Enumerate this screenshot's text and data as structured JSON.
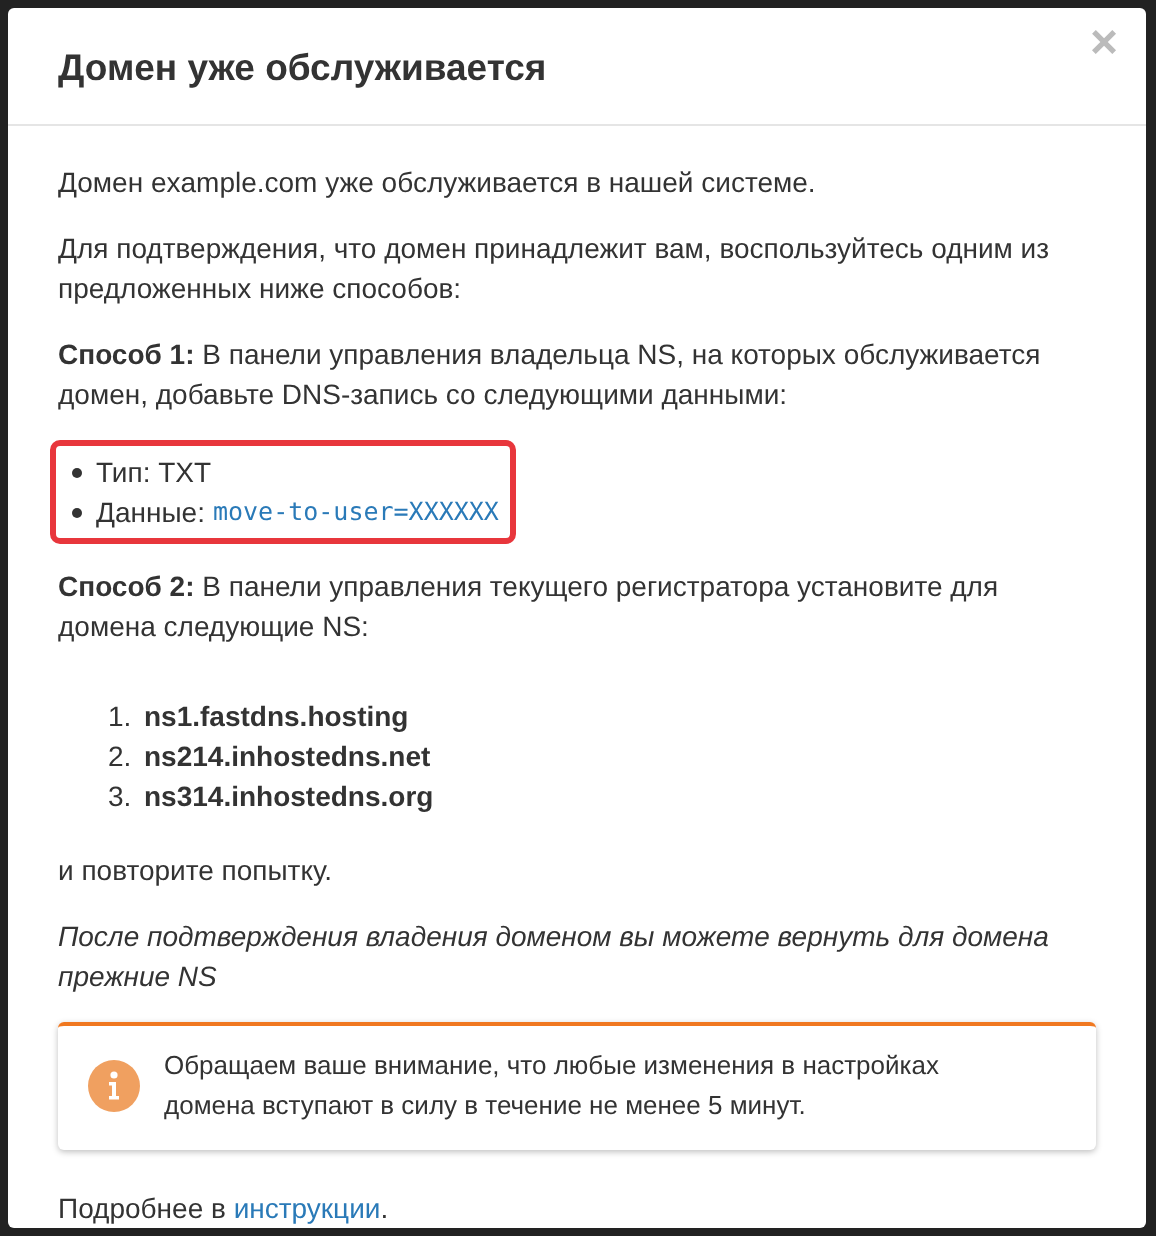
{
  "dialog": {
    "title": "Домен уже обслуживается",
    "close": "×"
  },
  "body": {
    "intro": "Домен example.com уже обслуживается в нашей системе.",
    "prompt": "Для подтверждения, что домен принадлежит вам, воспользуйтесь одним из предложенных ниже способов:",
    "method_1": "**Способ 1:** В панели управления владельца NS, на которых обслуживается домен, добавьте DNS-запись со следующими данными:",
    "record": [
      {
        "label": "Тип: TXT"
      },
      {
        "label": "Данные:",
        "code": "move-to-user=XXXXXX"
      }
    ],
    "method_2": "**Способ 2:** В панели управления текущего регистратора установите для домена следующие NS:",
    "nameservers": [
      {
        "number": "1.",
        "host": "ns1.fastdns.hosting"
      },
      {
        "number": "2.",
        "host": "ns214.inhostedns.net"
      },
      {
        "number": "3.",
        "host": "ns314.inhostedns.org"
      }
    ],
    "retry": "и повторите попытку.",
    "note": "После подтверждения владения доменом вы можете вернуть для домена прежние NS",
    "alert": {
      "text": "Обращаем ваше внимание, что любые изменения в настройках домена вступают в силу в течение не менее 5 минут."
    },
    "more": {
      "text": "Подробнее в",
      "link": "инструкции",
      "end": "."
    }
  }
}
